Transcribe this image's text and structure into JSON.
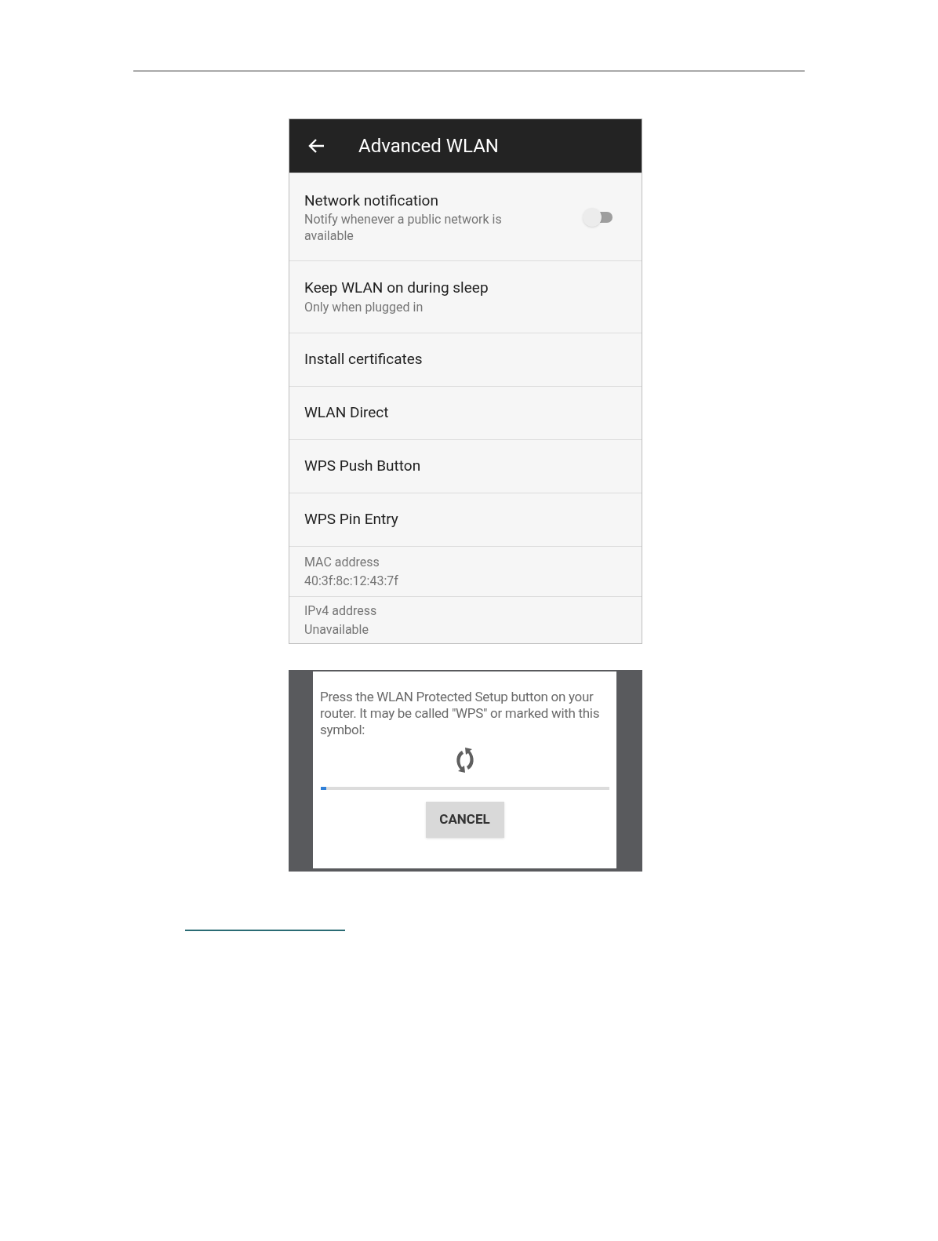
{
  "settings_screen": {
    "title": "Advanced WLAN",
    "rows": [
      {
        "kind": "toggle",
        "title": "Network notification",
        "subtitle": "Notify whenever a public network is available",
        "on": false
      },
      {
        "kind": "subtitle",
        "title": "Keep WLAN on during sleep",
        "subtitle": "Only when plugged in"
      },
      {
        "kind": "plain",
        "title": "Install certificates"
      },
      {
        "kind": "plain",
        "title": "WLAN Direct"
      },
      {
        "kind": "plain",
        "title": "WPS Push Button"
      },
      {
        "kind": "plain",
        "title": "WPS Pin Entry"
      },
      {
        "kind": "info",
        "title": "MAC address",
        "subtitle": "40:3f:8c:12:43:7f"
      },
      {
        "kind": "info",
        "title": "IPv4 address",
        "subtitle": "Unavailable"
      }
    ]
  },
  "wps_dialog_screen": {
    "message": "Press the WLAN Protected Setup button on your router. It may be called \"WPS\" or marked with this symbol:",
    "progress": {
      "level": 0.02
    },
    "button": "CANCEL"
  }
}
